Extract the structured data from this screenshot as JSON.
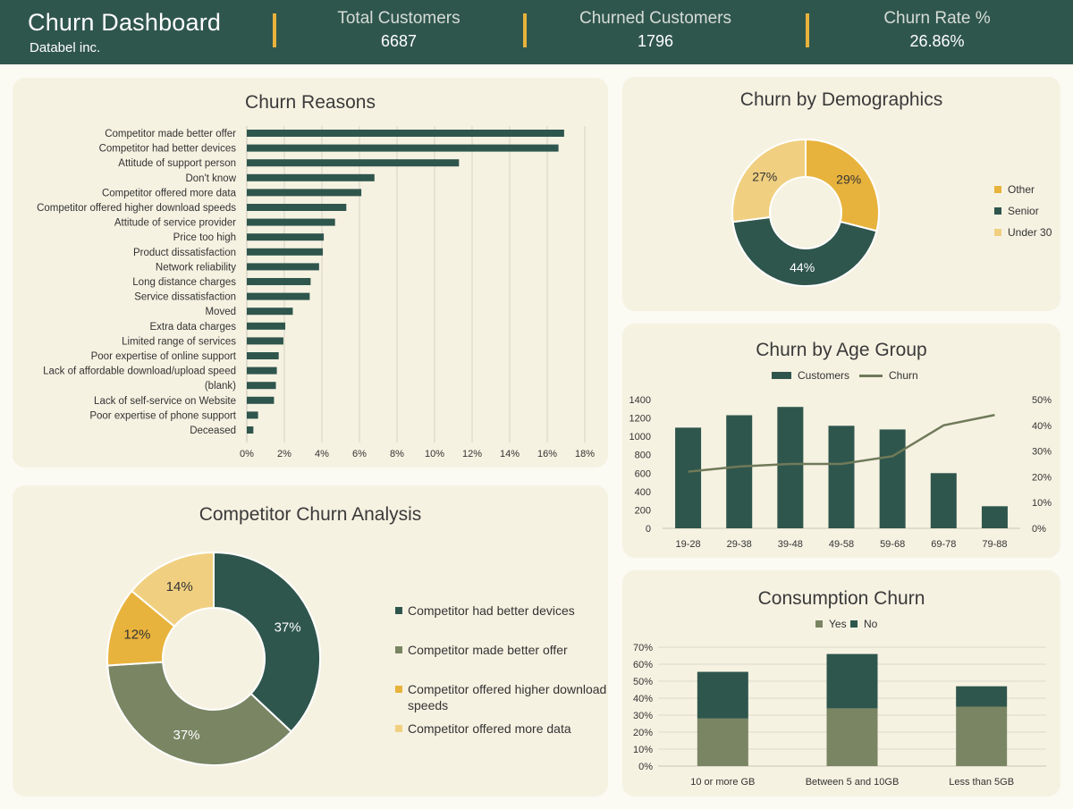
{
  "header": {
    "title": "Churn Dashboard",
    "subtitle": "Databel inc.",
    "kpis": [
      {
        "label": "Total Customers",
        "value": "6687"
      },
      {
        "label": "Churned Customers",
        "value": "1796"
      },
      {
        "label": "Churn Rate %",
        "value": "26.86%"
      }
    ]
  },
  "colors": {
    "dark_green": "#2f564d",
    "olive": "#7a8563",
    "gold": "#e8b33c",
    "light_gold": "#f0d080",
    "panel_bg": "#f6f2e2",
    "page_bg": "#fbfaf3"
  },
  "chart_data": [
    {
      "id": "churn_reasons",
      "type": "bar",
      "orientation": "horizontal",
      "title": "Churn Reasons",
      "categories": [
        "Competitor made better offer",
        "Competitor had better devices",
        "Attitude of support person",
        "Don't know",
        "Competitor offered more data",
        "Competitor offered higher download speeds",
        "Attitude of service provider",
        "Price too high",
        "Product dissatisfaction",
        "Network reliability",
        "Long distance charges",
        "Service dissatisfaction",
        "Moved",
        "Extra data charges",
        "Limited range of services",
        "Poor expertise of online support",
        "Lack of affordable download/upload speed",
        "(blank)",
        "Lack of self-service on Website",
        "Poor expertise of phone support",
        "Deceased"
      ],
      "values": [
        16.9,
        16.6,
        11.3,
        6.8,
        6.1,
        5.3,
        4.7,
        4.1,
        4.05,
        3.85,
        3.4,
        3.35,
        2.45,
        2.05,
        1.95,
        1.7,
        1.6,
        1.55,
        1.45,
        0.6,
        0.35
      ],
      "xlim": [
        0,
        18
      ],
      "xticks": [
        "0%",
        "2%",
        "4%",
        "6%",
        "8%",
        "10%",
        "12%",
        "14%",
        "16%",
        "18%"
      ],
      "grid": true
    },
    {
      "id": "churn_by_demographics",
      "type": "pie",
      "donut": true,
      "title": "Churn by Demographics",
      "labels": [
        "Other",
        "Senior",
        "Under 30"
      ],
      "values": [
        29,
        44,
        27
      ],
      "data_labels": [
        "29%",
        "44%",
        "27%"
      ],
      "colors": [
        "#e8b33c",
        "#2f564d",
        "#f0d080"
      ],
      "legend": "right"
    },
    {
      "id": "churn_by_age_group",
      "type": "bar",
      "combo": true,
      "title": "Churn by Age Group",
      "categories": [
        "19-28",
        "29-38",
        "39-48",
        "49-58",
        "59-68",
        "69-78",
        "79-88"
      ],
      "series": [
        {
          "name": "Customers",
          "type": "bar",
          "axis": "left",
          "values": [
            1095,
            1230,
            1320,
            1115,
            1075,
            600,
            240
          ]
        },
        {
          "name": "Churn",
          "type": "line",
          "axis": "right",
          "values": [
            22,
            24,
            25,
            25,
            28,
            40,
            44
          ]
        }
      ],
      "ylim_left": [
        0,
        1400
      ],
      "yticks_left": [
        "0",
        "200",
        "400",
        "600",
        "800",
        "1000",
        "1200",
        "1400"
      ],
      "ylim_right": [
        0,
        50
      ],
      "yticks_right": [
        "0%",
        "10%",
        "20%",
        "30%",
        "40%",
        "50%"
      ],
      "legend": "top"
    },
    {
      "id": "competitor_churn_analysis",
      "type": "pie",
      "donut": true,
      "title": "Competitor Churn Analysis",
      "labels": [
        "Competitor had better devices",
        "Competitor made better offer",
        "Competitor offered higher download speeds",
        "Competitor offered more data"
      ],
      "values": [
        37,
        37,
        12,
        14
      ],
      "data_labels": [
        "37%",
        "37%",
        "12%",
        "14%"
      ],
      "colors": [
        "#2f564d",
        "#7a8563",
        "#e8b33c",
        "#f0d080"
      ],
      "legend": "right"
    },
    {
      "id": "consumption_churn",
      "type": "bar",
      "stacked": true,
      "title": "Consumption Churn",
      "categories": [
        "10 or more GB",
        "Between 5 and 10GB",
        "Less than 5GB"
      ],
      "series": [
        {
          "name": "Yes",
          "values": [
            28,
            34,
            35
          ]
        },
        {
          "name": "No",
          "values": [
            27.5,
            32,
            12
          ]
        }
      ],
      "ylim": [
        0,
        70
      ],
      "yticks": [
        "0%",
        "10%",
        "20%",
        "30%",
        "40%",
        "50%",
        "60%",
        "70%"
      ],
      "legend": "top"
    }
  ]
}
